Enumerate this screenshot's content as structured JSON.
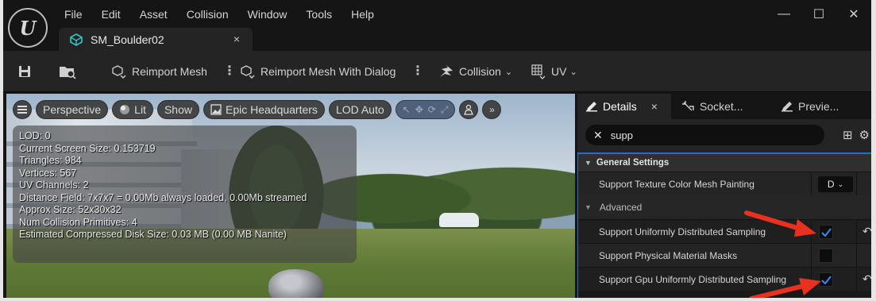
{
  "app": {
    "logo_text": "U"
  },
  "menu": [
    "File",
    "Edit",
    "Asset",
    "Collision",
    "Window",
    "Tools",
    "Help"
  ],
  "asset_tab": {
    "label": "SM_Boulder02",
    "close": "×"
  },
  "window_controls": {
    "minimize": "—",
    "maximize": "☐",
    "close": "✕"
  },
  "toolbar": {
    "reimport": "Reimport Mesh",
    "reimport_dialog": "Reimport Mesh With Dialog",
    "collision": "Collision",
    "uv": "UV"
  },
  "viewport": {
    "perspective": "Perspective",
    "lit": "Lit",
    "show": "Show",
    "environment": "Epic Headquarters",
    "lod": "LOD Auto",
    "stats": [
      "LOD: 0",
      "Current Screen Size: 0.153719",
      "Triangles: 984",
      "Vertices: 567",
      "UV Channels: 2",
      "Distance Field: 7x7x7 = 0.00Mb always loaded, 0.00Mb streamed",
      "Approx Size: 52x30x32",
      "Num Collision Primitives: 4",
      "Estimated Compressed Disk Size: 0.03 MB (0.00 MB Nanite)"
    ]
  },
  "details": {
    "tabs": [
      {
        "label": "Details",
        "close": "×"
      },
      {
        "label": "Socket..."
      },
      {
        "label": "Previe..."
      }
    ],
    "search_value": "supp",
    "category": "General Settings",
    "subcategory": "Advanced",
    "texture_row": {
      "label": "Support Texture Color Mesh Painting",
      "value": "D"
    },
    "rows": [
      {
        "label": "Support Uniformly Distributed Sampling",
        "checked": true
      },
      {
        "label": "Support Physical Material Masks",
        "checked": false
      },
      {
        "label": "Support Gpu Uniformly Distributed Sampling",
        "checked": true
      }
    ]
  },
  "colors": {
    "accent": "#1f6fd6",
    "checkmark": "#2f8cff",
    "annotation_arrow": "#e8321f"
  }
}
